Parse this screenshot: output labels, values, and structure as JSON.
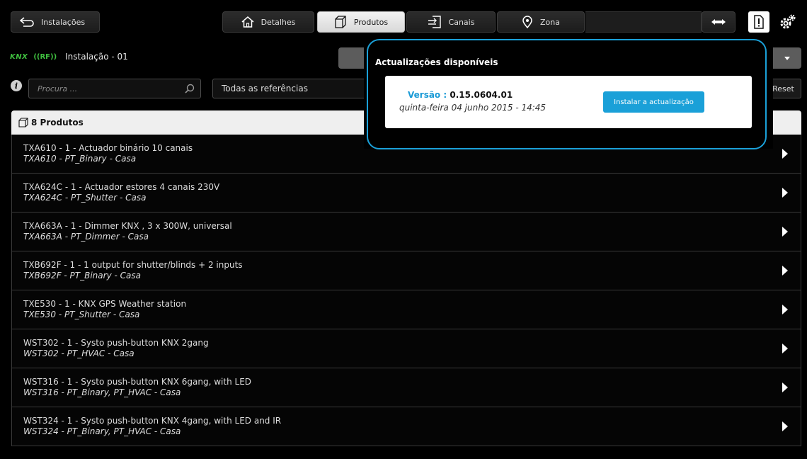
{
  "topbar": {
    "back_label": "Instalações",
    "tabs": [
      {
        "label": "Detalhes",
        "icon": "house-icon"
      },
      {
        "label": "Produtos",
        "icon": "box-icon",
        "active": true
      },
      {
        "label": "Canais",
        "icon": "channel-icon"
      },
      {
        "label": "Zona",
        "icon": "location-pin-icon"
      }
    ]
  },
  "installation": {
    "logo_knx": "KNX",
    "logo_rf": "((RF))",
    "name": "Instalação - 01"
  },
  "filters": {
    "search_placeholder": "Procura ...",
    "reference_filter": "Todas as referências",
    "reset_label": "Reset"
  },
  "products": {
    "header": "8 Produtos",
    "items": [
      {
        "title": "TXA610 - 1 - Actuador binário 10 canais",
        "subtitle": "TXA610 - PT_Binary - Casa"
      },
      {
        "title": "TXA624C - 1 - Actuador estores 4 canais 230V",
        "subtitle": "TXA624C - PT_Shutter - Casa"
      },
      {
        "title": "TXA663A - 1 - Dimmer KNX , 3 x 300W, universal",
        "subtitle": "TXA663A - PT_Dimmer - Casa"
      },
      {
        "title": "TXB692F - 1 - 1 output for shutter/blinds + 2 inputs",
        "subtitle": "TXB692F - PT_Binary - Casa"
      },
      {
        "title": "TXE530 - 1 - KNX GPS Weather station",
        "subtitle": "TXE530 - PT_Shutter - Casa"
      },
      {
        "title": "WST302 - 1 - Systo push-button KNX 2gang",
        "subtitle": "WST302 - PT_HVAC - Casa"
      },
      {
        "title": "WST316 - 1 - Systo push-button KNX 6gang, with LED",
        "subtitle": "WST316 - PT_Binary, PT_HVAC - Casa"
      },
      {
        "title": "WST324 - 1 - Systo push-button KNX 4gang, with LED and IR",
        "subtitle": "WST324 - PT_Binary, PT_HVAC - Casa"
      }
    ]
  },
  "update_popup": {
    "title": "Actualizações disponíveis",
    "version_label": "Versão :",
    "version_value": "0.15.0604.01",
    "date": "quinta-feira 04 junho 2015 - 14:45",
    "install_button": "Instalar a actualização"
  },
  "colors": {
    "accent_blue": "#1aa0d8",
    "knx_green": "#3fbf3f"
  }
}
